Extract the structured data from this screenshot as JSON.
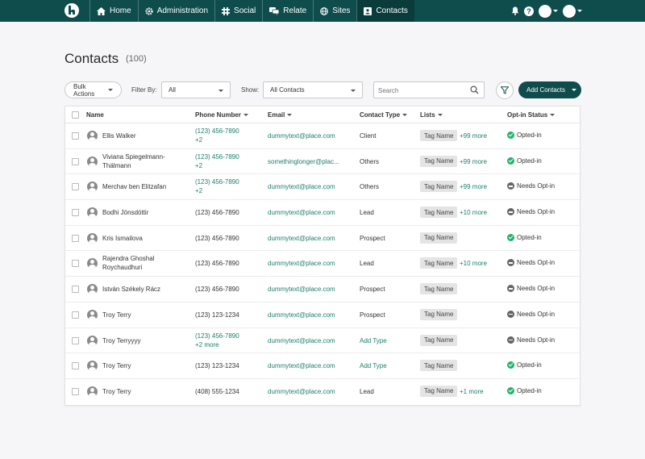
{
  "nav": {
    "items": [
      {
        "label": "Home",
        "icon": "home-icon"
      },
      {
        "label": "Administration",
        "icon": "gear-icon"
      },
      {
        "label": "Social",
        "icon": "hashtag-icon"
      },
      {
        "label": "Relate",
        "icon": "chat-icon"
      },
      {
        "label": "Sites",
        "icon": "globe-icon"
      },
      {
        "label": "Contacts",
        "icon": "contact-card-icon"
      }
    ],
    "active": "Contacts"
  },
  "page": {
    "title": "Contacts",
    "count": "(100)"
  },
  "toolbar": {
    "bulk_actions": "Bulk Actions",
    "filter_by_label": "Filter By:",
    "filter_value": "All",
    "show_label": "Show:",
    "show_value": "All Contacts",
    "search_placeholder": "Search",
    "add_contacts": "Add Contacts"
  },
  "table": {
    "headers": {
      "name": "Name",
      "phone": "Phone Number",
      "email": "Email",
      "contact_type": "Contact Type",
      "lists": "Lists",
      "optin": "Opt-in Status"
    },
    "rows": [
      {
        "name": "Ellis Walker",
        "phone": "(123) 456-7890",
        "phone_more": "+2",
        "email": "dummytext@place.com",
        "type": "Client",
        "type_link": false,
        "tag": "Tag Name",
        "more": "+99 more",
        "status": "Opted-in",
        "status_kind": "ok"
      },
      {
        "name": "Viviana Spiegelmann-Thälmann",
        "phone": "(123) 456-7890",
        "phone_more": "+2",
        "email": "somethinglonger@plac...",
        "type": "Others",
        "type_link": false,
        "tag": "Tag Name",
        "more": "+99 more",
        "status": "Opted-in",
        "status_kind": "ok"
      },
      {
        "name": "Merchav ben Elitzafan",
        "phone": "(123) 456-7890",
        "phone_more": "+2",
        "email": "dummytext@place.com",
        "type": "Others",
        "type_link": false,
        "tag": "Tag Name",
        "more": "+99 more",
        "status": "Needs Opt-in",
        "status_kind": "need"
      },
      {
        "name": "Bodhi Jönsdóttir",
        "phone": "(123) 456-7890",
        "phone_more": "",
        "email": "dummytext@place.com",
        "type": "Lead",
        "type_link": false,
        "tag": "Tag Name",
        "more": "+10 more",
        "status": "Needs Opt-in",
        "status_kind": "need"
      },
      {
        "name": "Kris Ismailova",
        "phone": "(123) 456-7890",
        "phone_more": "",
        "email": "dummytext@place.com",
        "type": "Prospect",
        "type_link": false,
        "tag": "Tag Name",
        "more": "",
        "status": "Opted-in",
        "status_kind": "ok"
      },
      {
        "name": "Rajendra Ghoshal Roychaudhuri",
        "phone": "(123) 456-7890",
        "phone_more": "",
        "email": "dummytext@place.com",
        "type": "Lead",
        "type_link": false,
        "tag": "Tag Name",
        "more": "+10 more",
        "status": "Needs Opt-in",
        "status_kind": "need"
      },
      {
        "name": "István Székely Rácz",
        "phone": "(123) 456-7890",
        "phone_more": "",
        "email": "dummytext@place.com",
        "type": "Prospect",
        "type_link": false,
        "tag": "Tag Name",
        "more": "",
        "status": "Needs Opt-in",
        "status_kind": "need"
      },
      {
        "name": "Troy Terry",
        "phone": "(123) 123-1234",
        "phone_more": "",
        "email": "dummytext@place.com",
        "type": "Prospect",
        "type_link": false,
        "tag": "Tag Name",
        "more": "",
        "status": "Needs Opt-in",
        "status_kind": "need"
      },
      {
        "name": "Troy Terryyyy",
        "phone": "(123) 456-7890",
        "phone_more": "+2 more",
        "email": "dummytext@place.com",
        "type": "Add Type",
        "type_link": true,
        "tag": "Tag Name",
        "more": "",
        "status": "Needs Opt-in",
        "status_kind": "need"
      },
      {
        "name": "Troy Terry",
        "phone": "(123) 123-1234",
        "phone_more": "",
        "email": "dummytext@place.com",
        "type": "Add Type",
        "type_link": true,
        "tag": "Tag Name",
        "more": "",
        "status": "Opted-in",
        "status_kind": "ok"
      },
      {
        "name": "Troy Terry",
        "phone": "(408) 555-1234",
        "phone_more": "",
        "email": "dummytext@place.com",
        "type": "Lead",
        "type_link": false,
        "tag": "Tag Name",
        "more": "+1  more",
        "status": "Opted-in",
        "status_kind": "ok"
      }
    ]
  },
  "colors": {
    "nav_bg": "#0f4c4c",
    "link": "#1a7f6a",
    "opted_in": "#23b26d",
    "needs_optin": "#666666"
  }
}
